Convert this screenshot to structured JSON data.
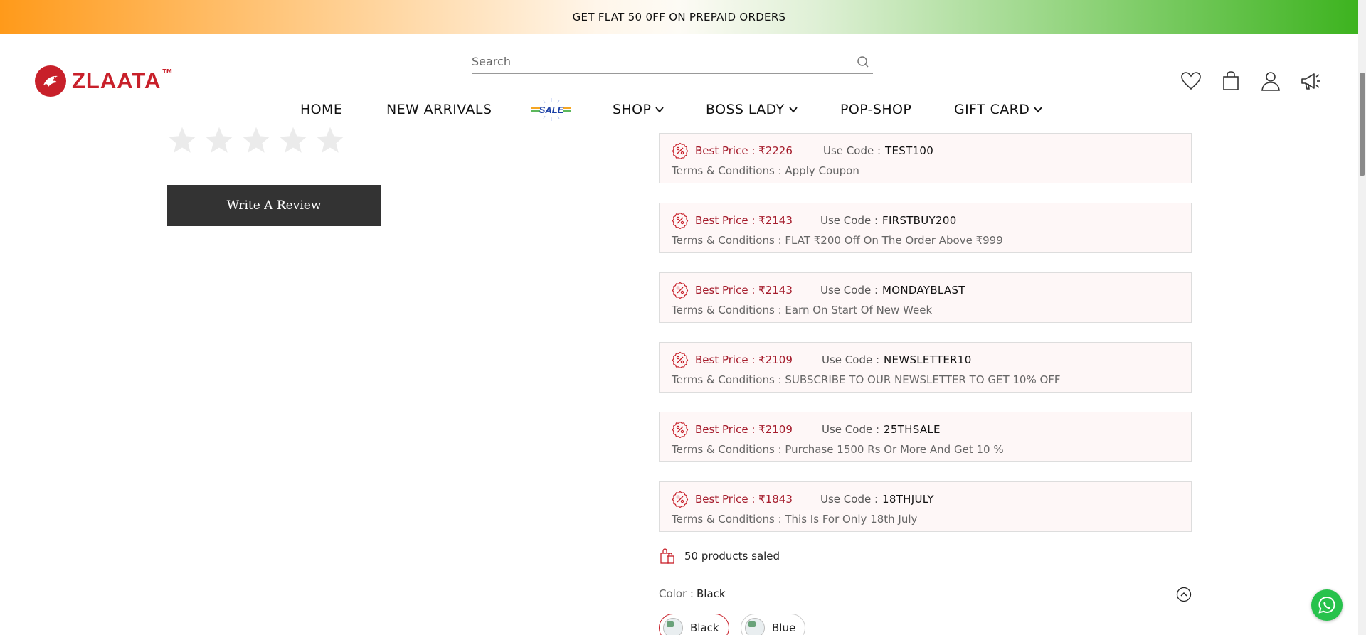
{
  "announcement": "GET FLAT 50 0FF ON PREPAID ORDERS",
  "brand": {
    "name": "ZLAATA",
    "tm": "TM"
  },
  "search": {
    "placeholder": "Search"
  },
  "nav": [
    {
      "label": "HOME"
    },
    {
      "label": "NEW ARRIVALS"
    },
    {
      "label": "SALE"
    },
    {
      "label": "SHOP"
    },
    {
      "label": "BOSS LADY"
    },
    {
      "label": "POP-SHOP"
    },
    {
      "label": "GIFT CARD"
    }
  ],
  "header_icons": [
    "heart-icon",
    "bag-icon",
    "user-icon",
    "megaphone-icon"
  ],
  "rating": {
    "filled": 0,
    "out_of": 5
  },
  "review_button": "Write A Review",
  "coupon_labels": {
    "best_price": "Best Price : ",
    "use_code": "Use Code : ",
    "terms": "Terms & Conditions : "
  },
  "coupons": [
    {
      "price": "₹2226",
      "code": "TEST100",
      "terms": "Apply Coupon"
    },
    {
      "price": "₹2143",
      "code": "FIRSTBUY200",
      "terms": "FLAT ₹200 Off On The Order Above ₹999"
    },
    {
      "price": "₹2143",
      "code": "MONDAYBLAST",
      "terms": "Earn On Start Of New Week"
    },
    {
      "price": "₹2109",
      "code": "NEWSLETTER10",
      "terms": "SUBSCRIBE TO OUR NEWSLETTER TO GET 10% OFF"
    },
    {
      "price": "₹2109",
      "code": "25THSALE",
      "terms": "Purchase 1500 Rs Or More And Get 10 %"
    },
    {
      "price": "₹1843",
      "code": "18THJULY",
      "terms": "This Is For Only 18th July"
    }
  ],
  "sold": "50 products saled",
  "color": {
    "label": "Color : ",
    "value": "Black",
    "options": [
      "Black",
      "Blue"
    ]
  },
  "colors": {
    "brand_red": "#c8202a",
    "price_red": "#a51c2c",
    "button_dark": "#333333",
    "whatsapp_green": "#27c24c"
  }
}
